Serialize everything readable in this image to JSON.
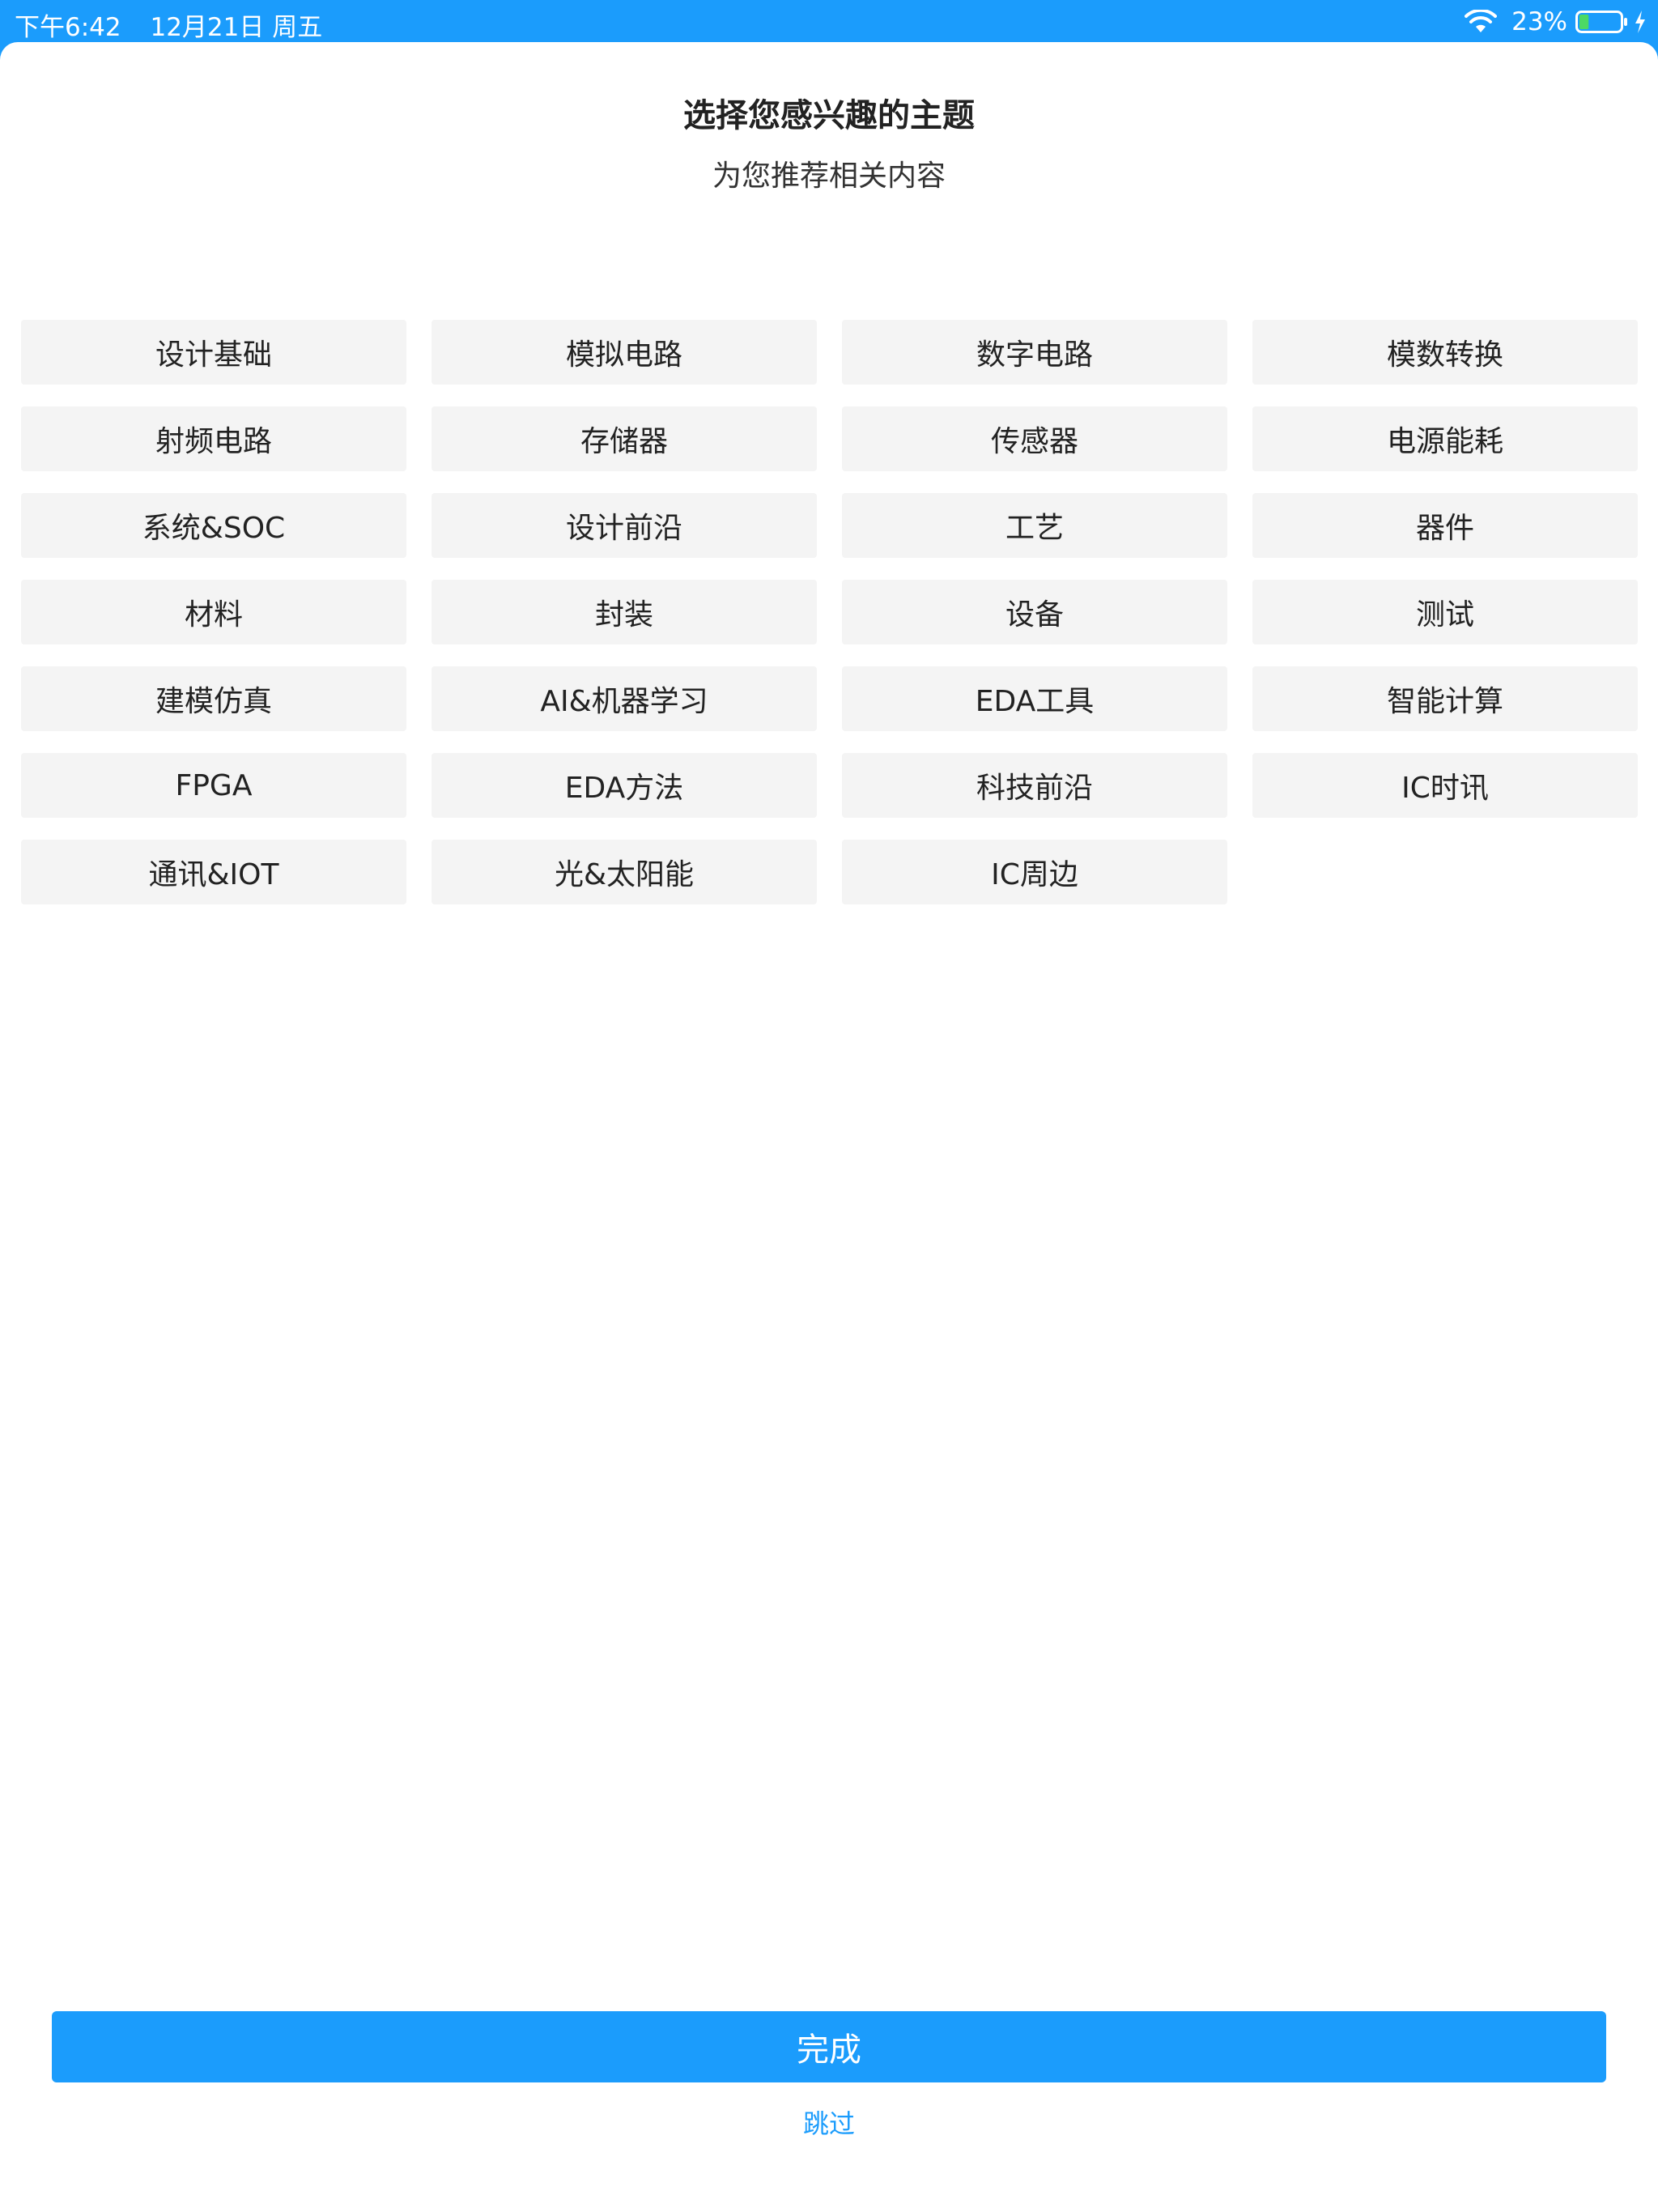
{
  "status_bar": {
    "time": "下午6:42",
    "date": "12月21日 周五",
    "battery_percent": "23%",
    "battery_level": 0.23,
    "battery_fill_color": "#4cd964",
    "icons": [
      "wifi-icon",
      "battery-icon",
      "charging-bolt-icon"
    ]
  },
  "header": {
    "title": "选择您感兴趣的主题",
    "subtitle": "为您推荐相关内容"
  },
  "topics": [
    "设计基础",
    "模拟电路",
    "数字电路",
    "模数转换",
    "射频电路",
    "存储器",
    "传感器",
    "电源能耗",
    "系统&SOC",
    "设计前沿",
    "工艺",
    "器件",
    "材料",
    "封装",
    "设备",
    "测试",
    "建模仿真",
    "AI&机器学习",
    "EDA工具",
    "智能计算",
    "FPGA",
    "EDA方法",
    "科技前沿",
    "IC时讯",
    "通讯&IOT",
    "光&太阳能",
    "IC周边"
  ],
  "footer": {
    "done_label": "完成",
    "skip_label": "跳过"
  },
  "colors": {
    "accent": "#1b9cfc",
    "tag_background": "#f4f4f4",
    "text": "#222222"
  }
}
